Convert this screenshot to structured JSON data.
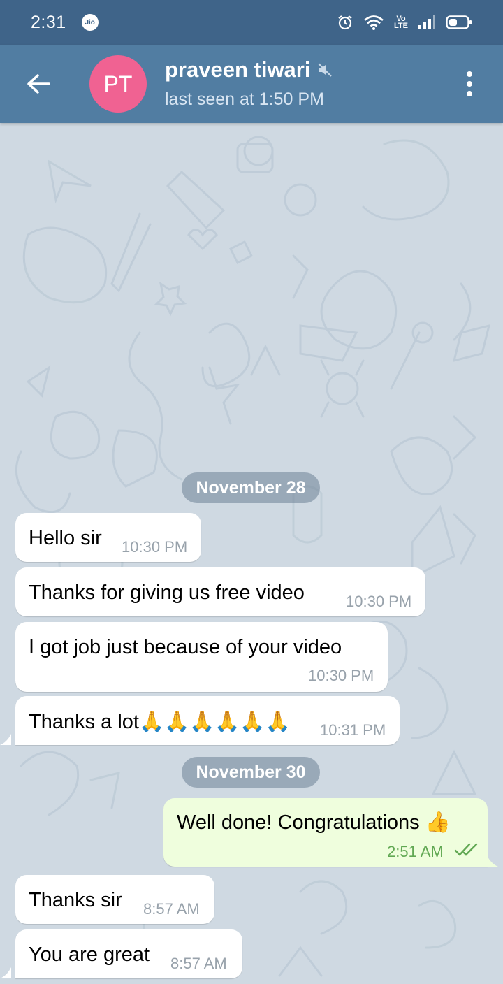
{
  "status_bar": {
    "time": "2:31",
    "carrier": "Jio",
    "volte": "Vo\nLTE",
    "icons": [
      "alarm-icon",
      "wifi-icon",
      "signal-icon",
      "battery-icon"
    ]
  },
  "header": {
    "avatar_initials": "PT",
    "avatar_color": "#f06292",
    "name": "praveen tiwari",
    "status": "last seen at 1:50 PM",
    "bar_color": "#517da2"
  },
  "chat": {
    "date_1": "November 28",
    "date_2": "November 30",
    "messages": [
      {
        "direction": "in",
        "text": "Hello sir",
        "time": "10:30 PM"
      },
      {
        "direction": "in",
        "text": "Thanks for giving us free video",
        "time": "10:30 PM"
      },
      {
        "direction": "in",
        "text": "I got job just because of your video",
        "time": "10:30 PM"
      },
      {
        "direction": "in",
        "text": "Thanks a lot🙏🙏🙏🙏🙏🙏",
        "time": "10:31 PM"
      },
      {
        "direction": "out",
        "text": "Well done! Congratulations 👍",
        "time": "2:51 AM"
      },
      {
        "direction": "in",
        "text": "Thanks sir",
        "time": "8:57 AM"
      },
      {
        "direction": "in",
        "text": "You are great",
        "time": "8:57 AM"
      }
    ],
    "outgoing_bubble_color": "#effedd",
    "background_color": "#cfd9e2"
  }
}
